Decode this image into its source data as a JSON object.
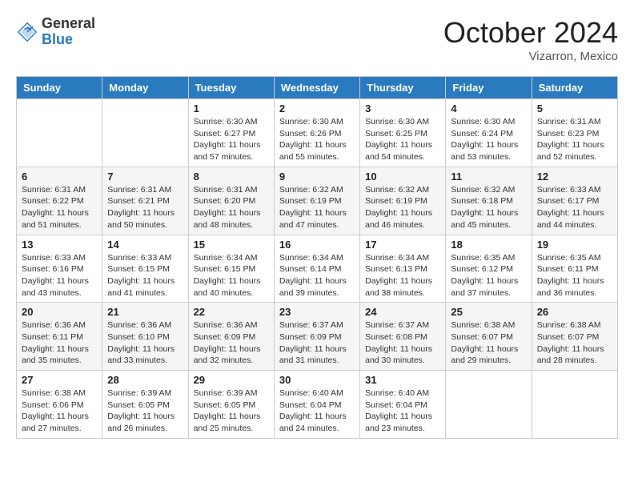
{
  "header": {
    "logo_general": "General",
    "logo_blue": "Blue",
    "month_title": "October 2024",
    "subtitle": "Vizarron, Mexico"
  },
  "days_of_week": [
    "Sunday",
    "Monday",
    "Tuesday",
    "Wednesday",
    "Thursday",
    "Friday",
    "Saturday"
  ],
  "weeks": [
    [
      {
        "day": "",
        "sunrise": "",
        "sunset": "",
        "daylight": ""
      },
      {
        "day": "",
        "sunrise": "",
        "sunset": "",
        "daylight": ""
      },
      {
        "day": "1",
        "sunrise": "Sunrise: 6:30 AM",
        "sunset": "Sunset: 6:27 PM",
        "daylight": "Daylight: 11 hours and 57 minutes."
      },
      {
        "day": "2",
        "sunrise": "Sunrise: 6:30 AM",
        "sunset": "Sunset: 6:26 PM",
        "daylight": "Daylight: 11 hours and 55 minutes."
      },
      {
        "day": "3",
        "sunrise": "Sunrise: 6:30 AM",
        "sunset": "Sunset: 6:25 PM",
        "daylight": "Daylight: 11 hours and 54 minutes."
      },
      {
        "day": "4",
        "sunrise": "Sunrise: 6:30 AM",
        "sunset": "Sunset: 6:24 PM",
        "daylight": "Daylight: 11 hours and 53 minutes."
      },
      {
        "day": "5",
        "sunrise": "Sunrise: 6:31 AM",
        "sunset": "Sunset: 6:23 PM",
        "daylight": "Daylight: 11 hours and 52 minutes."
      }
    ],
    [
      {
        "day": "6",
        "sunrise": "Sunrise: 6:31 AM",
        "sunset": "Sunset: 6:22 PM",
        "daylight": "Daylight: 11 hours and 51 minutes."
      },
      {
        "day": "7",
        "sunrise": "Sunrise: 6:31 AM",
        "sunset": "Sunset: 6:21 PM",
        "daylight": "Daylight: 11 hours and 50 minutes."
      },
      {
        "day": "8",
        "sunrise": "Sunrise: 6:31 AM",
        "sunset": "Sunset: 6:20 PM",
        "daylight": "Daylight: 11 hours and 48 minutes."
      },
      {
        "day": "9",
        "sunrise": "Sunrise: 6:32 AM",
        "sunset": "Sunset: 6:19 PM",
        "daylight": "Daylight: 11 hours and 47 minutes."
      },
      {
        "day": "10",
        "sunrise": "Sunrise: 6:32 AM",
        "sunset": "Sunset: 6:19 PM",
        "daylight": "Daylight: 11 hours and 46 minutes."
      },
      {
        "day": "11",
        "sunrise": "Sunrise: 6:32 AM",
        "sunset": "Sunset: 6:18 PM",
        "daylight": "Daylight: 11 hours and 45 minutes."
      },
      {
        "day": "12",
        "sunrise": "Sunrise: 6:33 AM",
        "sunset": "Sunset: 6:17 PM",
        "daylight": "Daylight: 11 hours and 44 minutes."
      }
    ],
    [
      {
        "day": "13",
        "sunrise": "Sunrise: 6:33 AM",
        "sunset": "Sunset: 6:16 PM",
        "daylight": "Daylight: 11 hours and 43 minutes."
      },
      {
        "day": "14",
        "sunrise": "Sunrise: 6:33 AM",
        "sunset": "Sunset: 6:15 PM",
        "daylight": "Daylight: 11 hours and 41 minutes."
      },
      {
        "day": "15",
        "sunrise": "Sunrise: 6:34 AM",
        "sunset": "Sunset: 6:15 PM",
        "daylight": "Daylight: 11 hours and 40 minutes."
      },
      {
        "day": "16",
        "sunrise": "Sunrise: 6:34 AM",
        "sunset": "Sunset: 6:14 PM",
        "daylight": "Daylight: 11 hours and 39 minutes."
      },
      {
        "day": "17",
        "sunrise": "Sunrise: 6:34 AM",
        "sunset": "Sunset: 6:13 PM",
        "daylight": "Daylight: 11 hours and 38 minutes."
      },
      {
        "day": "18",
        "sunrise": "Sunrise: 6:35 AM",
        "sunset": "Sunset: 6:12 PM",
        "daylight": "Daylight: 11 hours and 37 minutes."
      },
      {
        "day": "19",
        "sunrise": "Sunrise: 6:35 AM",
        "sunset": "Sunset: 6:11 PM",
        "daylight": "Daylight: 11 hours and 36 minutes."
      }
    ],
    [
      {
        "day": "20",
        "sunrise": "Sunrise: 6:36 AM",
        "sunset": "Sunset: 6:11 PM",
        "daylight": "Daylight: 11 hours and 35 minutes."
      },
      {
        "day": "21",
        "sunrise": "Sunrise: 6:36 AM",
        "sunset": "Sunset: 6:10 PM",
        "daylight": "Daylight: 11 hours and 33 minutes."
      },
      {
        "day": "22",
        "sunrise": "Sunrise: 6:36 AM",
        "sunset": "Sunset: 6:09 PM",
        "daylight": "Daylight: 11 hours and 32 minutes."
      },
      {
        "day": "23",
        "sunrise": "Sunrise: 6:37 AM",
        "sunset": "Sunset: 6:09 PM",
        "daylight": "Daylight: 11 hours and 31 minutes."
      },
      {
        "day": "24",
        "sunrise": "Sunrise: 6:37 AM",
        "sunset": "Sunset: 6:08 PM",
        "daylight": "Daylight: 11 hours and 30 minutes."
      },
      {
        "day": "25",
        "sunrise": "Sunrise: 6:38 AM",
        "sunset": "Sunset: 6:07 PM",
        "daylight": "Daylight: 11 hours and 29 minutes."
      },
      {
        "day": "26",
        "sunrise": "Sunrise: 6:38 AM",
        "sunset": "Sunset: 6:07 PM",
        "daylight": "Daylight: 11 hours and 28 minutes."
      }
    ],
    [
      {
        "day": "27",
        "sunrise": "Sunrise: 6:38 AM",
        "sunset": "Sunset: 6:06 PM",
        "daylight": "Daylight: 11 hours and 27 minutes."
      },
      {
        "day": "28",
        "sunrise": "Sunrise: 6:39 AM",
        "sunset": "Sunset: 6:05 PM",
        "daylight": "Daylight: 11 hours and 26 minutes."
      },
      {
        "day": "29",
        "sunrise": "Sunrise: 6:39 AM",
        "sunset": "Sunset: 6:05 PM",
        "daylight": "Daylight: 11 hours and 25 minutes."
      },
      {
        "day": "30",
        "sunrise": "Sunrise: 6:40 AM",
        "sunset": "Sunset: 6:04 PM",
        "daylight": "Daylight: 11 hours and 24 minutes."
      },
      {
        "day": "31",
        "sunrise": "Sunrise: 6:40 AM",
        "sunset": "Sunset: 6:04 PM",
        "daylight": "Daylight: 11 hours and 23 minutes."
      },
      {
        "day": "",
        "sunrise": "",
        "sunset": "",
        "daylight": ""
      },
      {
        "day": "",
        "sunrise": "",
        "sunset": "",
        "daylight": ""
      }
    ]
  ]
}
